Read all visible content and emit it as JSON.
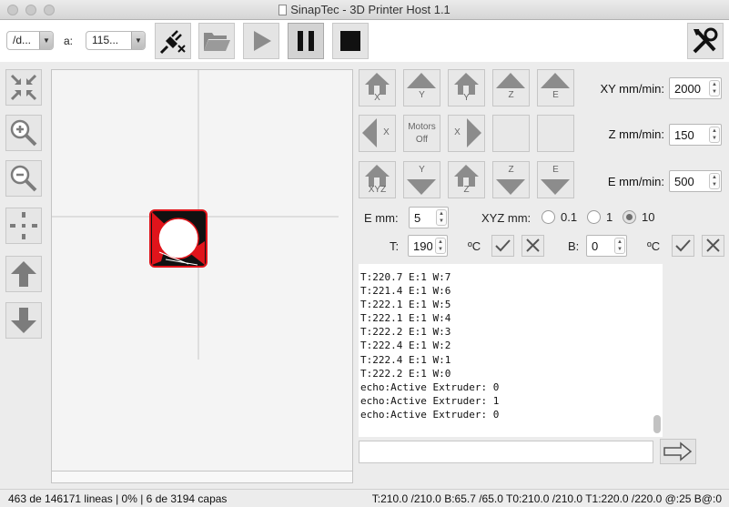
{
  "window": {
    "title": "SinapTec - 3D Printer Host 1.1"
  },
  "toolbar": {
    "port_value": "/d...",
    "baud_label": "a:",
    "baud_value": "115...",
    "icons": [
      "disconnect-plug-icon",
      "open-folder-icon",
      "play-icon",
      "pause-icon",
      "stop-icon",
      "settings-tools-icon"
    ]
  },
  "sidebar": {
    "icons": [
      "fit-view-icon",
      "zoom-in-icon",
      "zoom-out-icon",
      "center-view-icon",
      "layer-up-icon",
      "layer-down-icon"
    ]
  },
  "jog": {
    "home_x": "X",
    "move_y_plus": "Y",
    "home_y": "Y",
    "move_z_plus": "Z",
    "move_e_plus": "E",
    "move_x_minus": "X",
    "motors_off_line1": "Motors",
    "motors_off_line2": "Off",
    "move_x_plus": "X",
    "home_xyz": "XYZ",
    "move_y_minus": "Y",
    "home_z": "Z",
    "move_z_minus": "Z",
    "move_e_minus": "E"
  },
  "feedrates": {
    "xy_label": "XY mm/min:",
    "xy_value": "2000",
    "z_label": "Z mm/min:",
    "z_value": "150",
    "e_label": "E mm/min:",
    "e_value": "500"
  },
  "step": {
    "e_label": "E mm:",
    "e_value": "5",
    "xyz_label": "XYZ mm:",
    "options": [
      "0.1",
      "1",
      "10"
    ],
    "selected": "10"
  },
  "temps": {
    "t_label": "T:",
    "t_value": "190",
    "t_unit": "ºC",
    "b_label": "B:",
    "b_value": "0",
    "b_unit": "ºC"
  },
  "console_lines": [
    "T:220.7 E:1 W:7",
    "T:221.4 E:1 W:6",
    "T:222.1 E:1 W:5",
    "T:222.1 E:1 W:4",
    "T:222.2 E:1 W:3",
    "T:222.4 E:1 W:2",
    "T:222.4 E:1 W:1",
    "T:222.2 E:1 W:0",
    "echo:Active Extruder: 0",
    "echo:Active Extruder: 1",
    "echo:Active Extruder: 0"
  ],
  "command_input": {
    "value": ""
  },
  "status": {
    "left": "463 de 146171 lineas | 0% | 6 de 3194 capas",
    "right": "T:210.0 /210.0 B:65.7 /65.0 T0:210.0 /210.0 T1:220.0 /220.0 @:25 B@:0"
  },
  "colors": {
    "accent_red": "#e0141b",
    "button_gray": "#8c8c8c"
  }
}
